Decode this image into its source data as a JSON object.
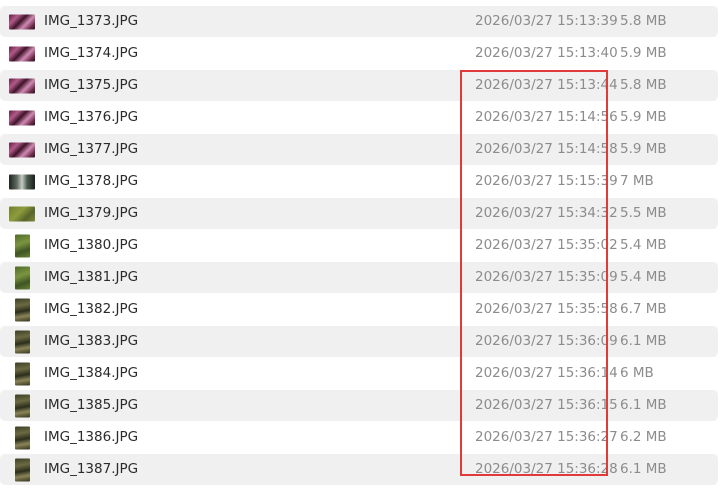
{
  "files": [
    {
      "name": "IMG_1373.JPG",
      "date": "2026/03/27 15:13:39",
      "size": "5.8 MB",
      "thumb": "flowers-icon"
    },
    {
      "name": "IMG_1374.JPG",
      "date": "2026/03/27 15:13:40",
      "size": "5.9 MB",
      "thumb": "flowers-icon"
    },
    {
      "name": "IMG_1375.JPG",
      "date": "2026/03/27 15:13:44",
      "size": "5.8 MB",
      "thumb": "flowers-icon"
    },
    {
      "name": "IMG_1376.JPG",
      "date": "2026/03/27 15:14:56",
      "size": "5.9 MB",
      "thumb": "flowers-icon"
    },
    {
      "name": "IMG_1377.JPG",
      "date": "2026/03/27 15:14:58",
      "size": "5.9 MB",
      "thumb": "flowers-icon"
    },
    {
      "name": "IMG_1378.JPG",
      "date": "2026/03/27 15:15:39",
      "size": "7 MB",
      "thumb": "street-icon"
    },
    {
      "name": "IMG_1379.JPG",
      "date": "2026/03/27 15:34:32",
      "size": "5.5 MB",
      "thumb": "grass-icon"
    },
    {
      "name": "IMG_1380.JPG",
      "date": "2026/03/27 15:35:02",
      "size": "5.4 MB",
      "thumb": "plant-icon"
    },
    {
      "name": "IMG_1381.JPG",
      "date": "2026/03/27 15:35:09",
      "size": "5.4 MB",
      "thumb": "plant-icon"
    },
    {
      "name": "IMG_1382.JPG",
      "date": "2026/03/27 15:35:58",
      "size": "6.7 MB",
      "thumb": "tree-icon"
    },
    {
      "name": "IMG_1383.JPG",
      "date": "2026/03/27 15:36:09",
      "size": "6.1 MB",
      "thumb": "tree-icon"
    },
    {
      "name": "IMG_1384.JPG",
      "date": "2026/03/27 15:36:14",
      "size": "6 MB",
      "thumb": "tree-icon"
    },
    {
      "name": "IMG_1385.JPG",
      "date": "2026/03/27 15:36:15",
      "size": "6.1 MB",
      "thumb": "tree-icon"
    },
    {
      "name": "IMG_1386.JPG",
      "date": "2026/03/27 15:36:27",
      "size": "6.2 MB",
      "thumb": "tree-icon"
    },
    {
      "name": "IMG_1387.JPG",
      "date": "2026/03/27 15:36:28",
      "size": "6.1 MB",
      "thumb": "tree-icon"
    }
  ],
  "highlight_color": "#e03a3a"
}
